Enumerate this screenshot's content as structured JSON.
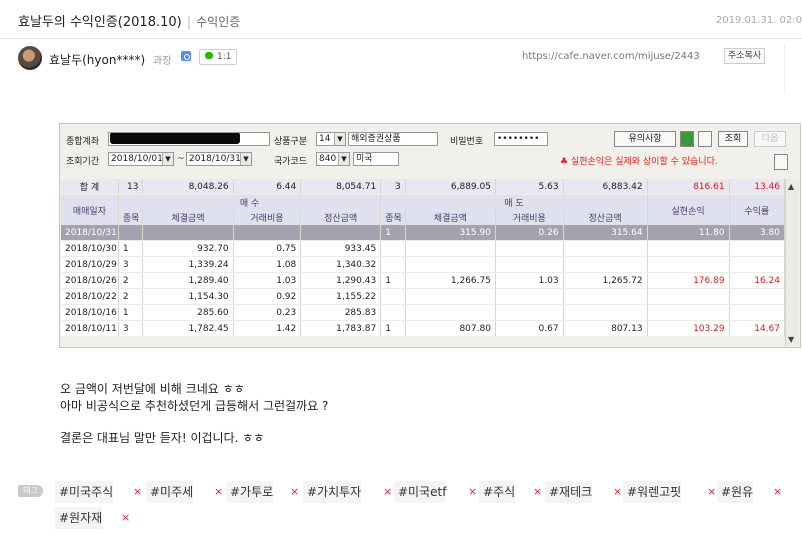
{
  "header": {
    "title": "효날두의 수익인증(2018.10)",
    "separator": "|",
    "category": "수익인증",
    "date": "2019.01.31. 02:0"
  },
  "author": {
    "name": "효날두(hyon****)",
    "grade": "과장",
    "chat_label": "1:1",
    "url": "https://cafe.naver.com/mijuse/2443",
    "copy_label": "주소복사"
  },
  "screenshot": {
    "labels": {
      "account": "종합계좌",
      "product_type": "상품구분",
      "product_code": "14",
      "product_name": "해외증권상품",
      "password": "비밀번호",
      "password_value": "••••••••",
      "notice_btn": "유의사항",
      "query_btn": "조회",
      "next_btn": "다음",
      "period": "조회기간",
      "date_from": "2018/10/01",
      "date_sep": "~",
      "date_to": "2018/10/31",
      "country_code": "국가코드",
      "country_num": "840",
      "country_name": "미국",
      "warning": "♣ 실현손익은 실제와 상이할 수 있습니다."
    },
    "total": [
      "합 계",
      "13",
      "8,048.26",
      "6.44",
      "8,054.71",
      "3",
      "6,889.05",
      "5.63",
      "6,883.42",
      "816.61",
      "13.46"
    ],
    "headers": {
      "date": "매매일자",
      "buy": "매 수",
      "sell": "매 도",
      "count": "종목",
      "exec_amt": "체결금액",
      "fee": "거래비용",
      "settle_amt": "정산금액",
      "realized": "실현손익",
      "yield": "수익률"
    },
    "rows": [
      [
        "2018/10/31",
        "",
        "",
        "",
        "",
        "1",
        "315.90",
        "0.26",
        "315.64",
        "11.80",
        "3.80"
      ],
      [
        "2018/10/30",
        "1",
        "932.70",
        "0.75",
        "933.45",
        "",
        "",
        "",
        "",
        "",
        ""
      ],
      [
        "2018/10/29",
        "3",
        "1,339.24",
        "1.08",
        "1,340.32",
        "",
        "",
        "",
        "",
        "",
        ""
      ],
      [
        "2018/10/26",
        "2",
        "1,289.40",
        "1.03",
        "1,290.43",
        "1",
        "1,266.75",
        "1.03",
        "1,265.72",
        "176.89",
        "16.24"
      ],
      [
        "2018/10/22",
        "2",
        "1,154.30",
        "0.92",
        "1,155.22",
        "",
        "",
        "",
        "",
        "",
        ""
      ],
      [
        "2018/10/16",
        "1",
        "285.60",
        "0.23",
        "285.83",
        "",
        "",
        "",
        "",
        "",
        ""
      ],
      [
        "2018/10/11",
        "3",
        "1,782.45",
        "1.42",
        "1,783.87",
        "1",
        "807.80",
        "0.67",
        "807.13",
        "103.29",
        "14.67"
      ]
    ]
  },
  "body": {
    "line1": "오 금액이 저번달에 비해 크네요 ㅎㅎ",
    "line2": "아마 비공식으로 추천하셨던게 급등해서 그런걸까요 ?",
    "line3": "결론은 대표님 말만 듣자! 이겁니다. ㅎㅎ"
  },
  "tags": {
    "icon_label": "태그",
    "remove_glyph": "×",
    "items": [
      "#미국주식",
      "#미주세",
      "#가투로",
      "#가치투자",
      "#미국etf",
      "#주식",
      "#재테크",
      "#워렌고핏",
      "#원유",
      "#원자재"
    ]
  },
  "colors": {
    "accent_red": "#d8191a",
    "header_purple": "#4a3d6c",
    "selected_row": "#a3a3ae"
  }
}
